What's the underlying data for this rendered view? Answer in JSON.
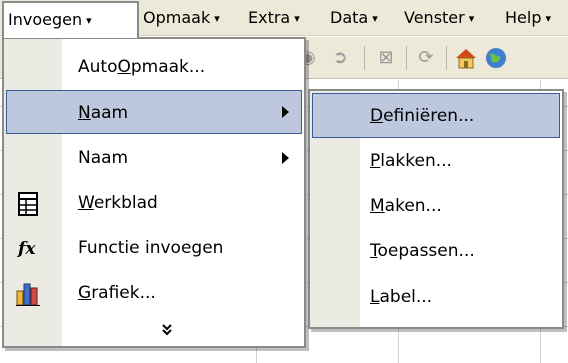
{
  "menubar": {
    "items": [
      {
        "label": "Invoegen",
        "arrow": "▾"
      },
      {
        "label": "Opmaak",
        "arrow": "▾"
      },
      {
        "label": "Extra",
        "arrow": "▾"
      },
      {
        "label": "Data",
        "arrow": "▾"
      },
      {
        "label": "Venster",
        "arrow": "▾"
      },
      {
        "label": "Help",
        "arrow": "▾"
      }
    ]
  },
  "menu1": {
    "items": [
      {
        "pre": "Auto",
        "ul": "O",
        "post": "pmaak...",
        "icon": "",
        "submenu": false,
        "highlighted": false
      },
      {
        "pre": "",
        "ul": "N",
        "post": "aam",
        "icon": "",
        "submenu": true,
        "highlighted": true
      },
      {
        "pre": "Naam",
        "ul": "",
        "post": "",
        "icon": "",
        "submenu": true,
        "highlighted": false
      },
      {
        "pre": "",
        "ul": "W",
        "post": "erkblad",
        "icon": "worksheet-icon",
        "submenu": false,
        "highlighted": false
      },
      {
        "pre": "Functie invoegen",
        "ul": "",
        "post": "",
        "icon": "function-icon",
        "submenu": false,
        "highlighted": false
      },
      {
        "pre": "",
        "ul": "G",
        "post": "rafiek...",
        "icon": "chart-icon",
        "submenu": false,
        "highlighted": false
      }
    ],
    "expand_glyph": "»",
    "function_icon_text": "fx"
  },
  "menu2": {
    "items": [
      {
        "pre": "",
        "ul": "D",
        "post": "efiniëren...",
        "highlighted": true
      },
      {
        "pre": "",
        "ul": "P",
        "post": "lakken...",
        "highlighted": false
      },
      {
        "pre": "",
        "ul": "M",
        "post": "aken...",
        "highlighted": false
      },
      {
        "pre": "",
        "ul": "T",
        "post": "oepassen...",
        "highlighted": false
      },
      {
        "pre": "",
        "ul": "L",
        "post": "abel...",
        "highlighted": false
      }
    ]
  },
  "colors": {
    "menubar_bg": "#ece9d8",
    "highlight_bg": "#bdc7dd",
    "highlight_border": "#3d5a98",
    "icon_strip": "#ecebe3"
  }
}
